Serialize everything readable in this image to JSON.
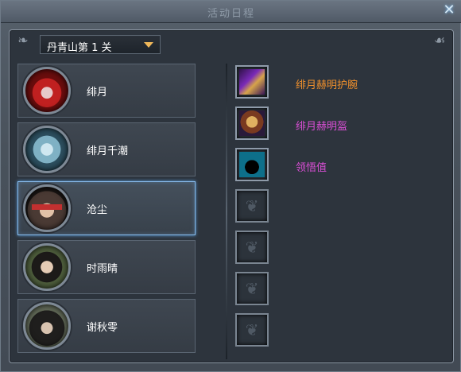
{
  "window": {
    "title": "活动日程",
    "close_glyph": "✕"
  },
  "dropdown": {
    "selected": "丹青山第 1 关"
  },
  "characters": [
    {
      "name": "绯月",
      "portrait": "red-masked-character-portrait",
      "selected": false
    },
    {
      "name": "绯月千潮",
      "portrait": "blue-beast-character-portrait",
      "selected": false
    },
    {
      "name": "沧尘",
      "portrait": "blindfolded-character-portrait",
      "selected": true
    },
    {
      "name": "时雨晴",
      "portrait": "female-character-portrait",
      "selected": false
    },
    {
      "name": "谢秋零",
      "portrait": "dark-haired-character-portrait",
      "selected": false
    }
  ],
  "rewards": [
    {
      "name": "绯月赫明护腕",
      "icon": "bracer-icon",
      "color": "#f0902c"
    },
    {
      "name": "绯月赫明盔",
      "icon": "helmet-icon",
      "color": "#d84ed4"
    },
    {
      "name": "领悟值",
      "icon": "insight-icon",
      "color": "#d84ed4"
    },
    {
      "name": "",
      "icon": "empty-slot-icon"
    },
    {
      "name": "",
      "icon": "empty-slot-icon"
    },
    {
      "name": "",
      "icon": "empty-slot-icon"
    },
    {
      "name": "",
      "icon": "empty-slot-icon"
    }
  ]
}
